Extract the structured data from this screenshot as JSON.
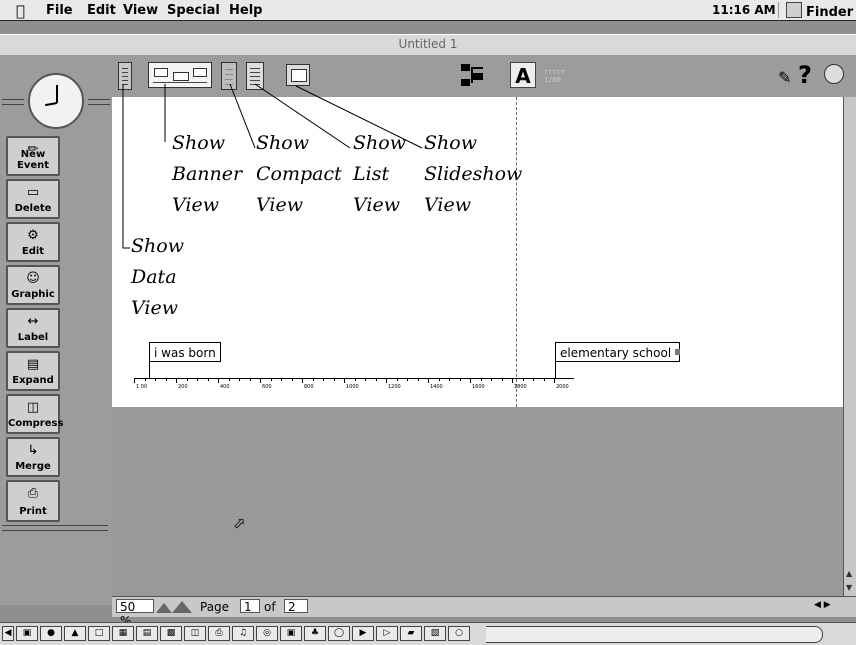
{
  "menubar": {
    "items": [
      "File",
      "Edit",
      "View",
      "Special",
      "Help"
    ],
    "clock": "11:16 AM",
    "app": "Finder"
  },
  "window": {
    "title": "Untitled 1"
  },
  "toolbar": {
    "buttons": [
      "data-view",
      "banner-view",
      "compact-view",
      "list-view",
      "slideshow-view",
      "tree",
      "font",
      "ruler",
      "document",
      "help",
      "web"
    ],
    "ruler_icon_text": "rrrrr\n1/00"
  },
  "sidebar": {
    "buttons": [
      {
        "label": "New Event",
        "icon": "pencil-icon"
      },
      {
        "label": "Delete",
        "icon": "eraser-icon"
      },
      {
        "label": "Edit",
        "icon": "wrench-icon"
      },
      {
        "label": "Graphic",
        "icon": "portrait-icon"
      },
      {
        "label": "Label",
        "icon": "label-icon"
      },
      {
        "label": "Expand",
        "icon": "expand-icon"
      },
      {
        "label": "Compress",
        "icon": "compress-icon"
      },
      {
        "label": "Merge",
        "icon": "merge-icon"
      },
      {
        "label": "Print",
        "icon": "printer-icon"
      }
    ]
  },
  "annotations": {
    "banner": [
      "Show",
      "Banner",
      "View"
    ],
    "compact": [
      "Show",
      "Compact",
      "View"
    ],
    "list": [
      "Show",
      "List",
      "View"
    ],
    "slideshow": [
      "Show",
      "Slideshow",
      "View"
    ],
    "data": [
      "Show",
      "Data",
      "View"
    ]
  },
  "timeline": {
    "events": [
      "i was born",
      "elementary school"
    ],
    "ticks": [
      "1 00",
      "200",
      "400",
      "600",
      "800",
      "1000",
      "1200",
      "1400",
      "1600",
      "1800",
      "2000"
    ]
  },
  "status": {
    "zoom": "50 %",
    "page_label": "Page",
    "page_current": "1",
    "of_label": "of",
    "page_total": "2"
  },
  "colors": {
    "canvas": "#ffffff",
    "chrome": "#9c9c9c",
    "workspace": "#999999"
  }
}
